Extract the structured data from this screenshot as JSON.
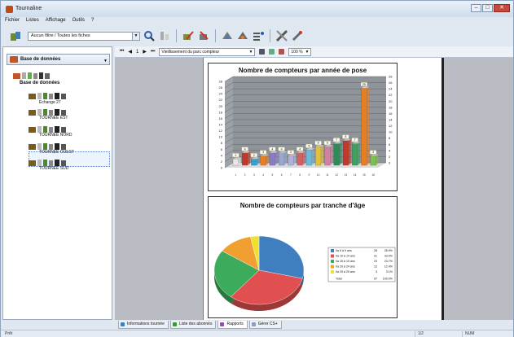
{
  "app": {
    "title": "Tournaline"
  },
  "menu": [
    "Fichier",
    "Listes",
    "Affichage",
    "Outils",
    "?"
  ],
  "toolbar": {
    "combo_value": "Aucun filtre / Toutes les fiches"
  },
  "left": {
    "header": "Base de données",
    "root_label": "Base de données",
    "items": [
      {
        "label": "Echange 27"
      },
      {
        "label": "TOURNEE EST"
      },
      {
        "label": "TOURNEE NORD"
      },
      {
        "label": "TOURNEE OUEST"
      },
      {
        "label": "TOURNEE SUD"
      }
    ]
  },
  "report_nav": {
    "page": "1",
    "report_name": "Vieillissement du parc compteur",
    "zoom": "100 %"
  },
  "chart_data": [
    {
      "type": "bar",
      "title": "Nombre de compteurs par année de pose",
      "categories": [
        "1",
        "2",
        "3",
        "4",
        "5",
        "6",
        "7",
        "8",
        "9",
        "10",
        "11",
        "12",
        "13",
        "14",
        "15",
        "16"
      ],
      "values": [
        2,
        4,
        2,
        3,
        4,
        4,
        3,
        4,
        5,
        6,
        6,
        7,
        8,
        7,
        25,
        3
      ],
      "colors": [
        "#e8e8e8",
        "#c0392b",
        "#3aa0c8",
        "#e67e22",
        "#8e7cc3",
        "#9aa8d0",
        "#b0b0d8",
        "#d65f5f",
        "#6fb8d8",
        "#e0c040",
        "#d080a0",
        "#2e8b57",
        "#c0392b",
        "#40a060",
        "#e67e22",
        "#7fbf4d"
      ],
      "ylim": [
        0,
        28
      ],
      "yticks": [
        "0",
        "2",
        "4",
        "6",
        "8",
        "10",
        "12",
        "14",
        "16",
        "18",
        "20",
        "22",
        "24",
        "26",
        "28"
      ]
    },
    {
      "type": "pie",
      "title": "Nombre de compteurs par tranche d'âge",
      "series": [
        {
          "name": "0a 5 à 9 ans",
          "value": 28,
          "percent": "28.9%",
          "color": "#3f7fc0"
        },
        {
          "name": "0a 10 à 14 ans",
          "value": 31,
          "percent": "33.0%",
          "color": "#e05050"
        },
        {
          "name": "0a 15 à 19 ans",
          "value": 23,
          "percent": "23.7%",
          "color": "#3cab5c"
        },
        {
          "name": "0a 20 à 24 ans",
          "value": 12,
          "percent": "12.4%",
          "color": "#f0a030"
        },
        {
          "name": "0a 25 à 29 ans",
          "value": 3,
          "percent": "3.1%",
          "color": "#f0e030"
        }
      ],
      "total_label": "Total",
      "total_value": "97",
      "total_percent": "100.0%"
    }
  ],
  "tabs": [
    {
      "label": "Informations tournée",
      "color": "#3f7fc0"
    },
    {
      "label": "Liste des abonnés",
      "color": "#3a9a3a"
    },
    {
      "label": "Rapports",
      "color": "#8a4fb0"
    },
    {
      "label": "Gérer CS+",
      "color": "#8aa0c0"
    }
  ],
  "status": {
    "left": "Prêt",
    "mid": "1/2",
    "right": "NUM"
  }
}
